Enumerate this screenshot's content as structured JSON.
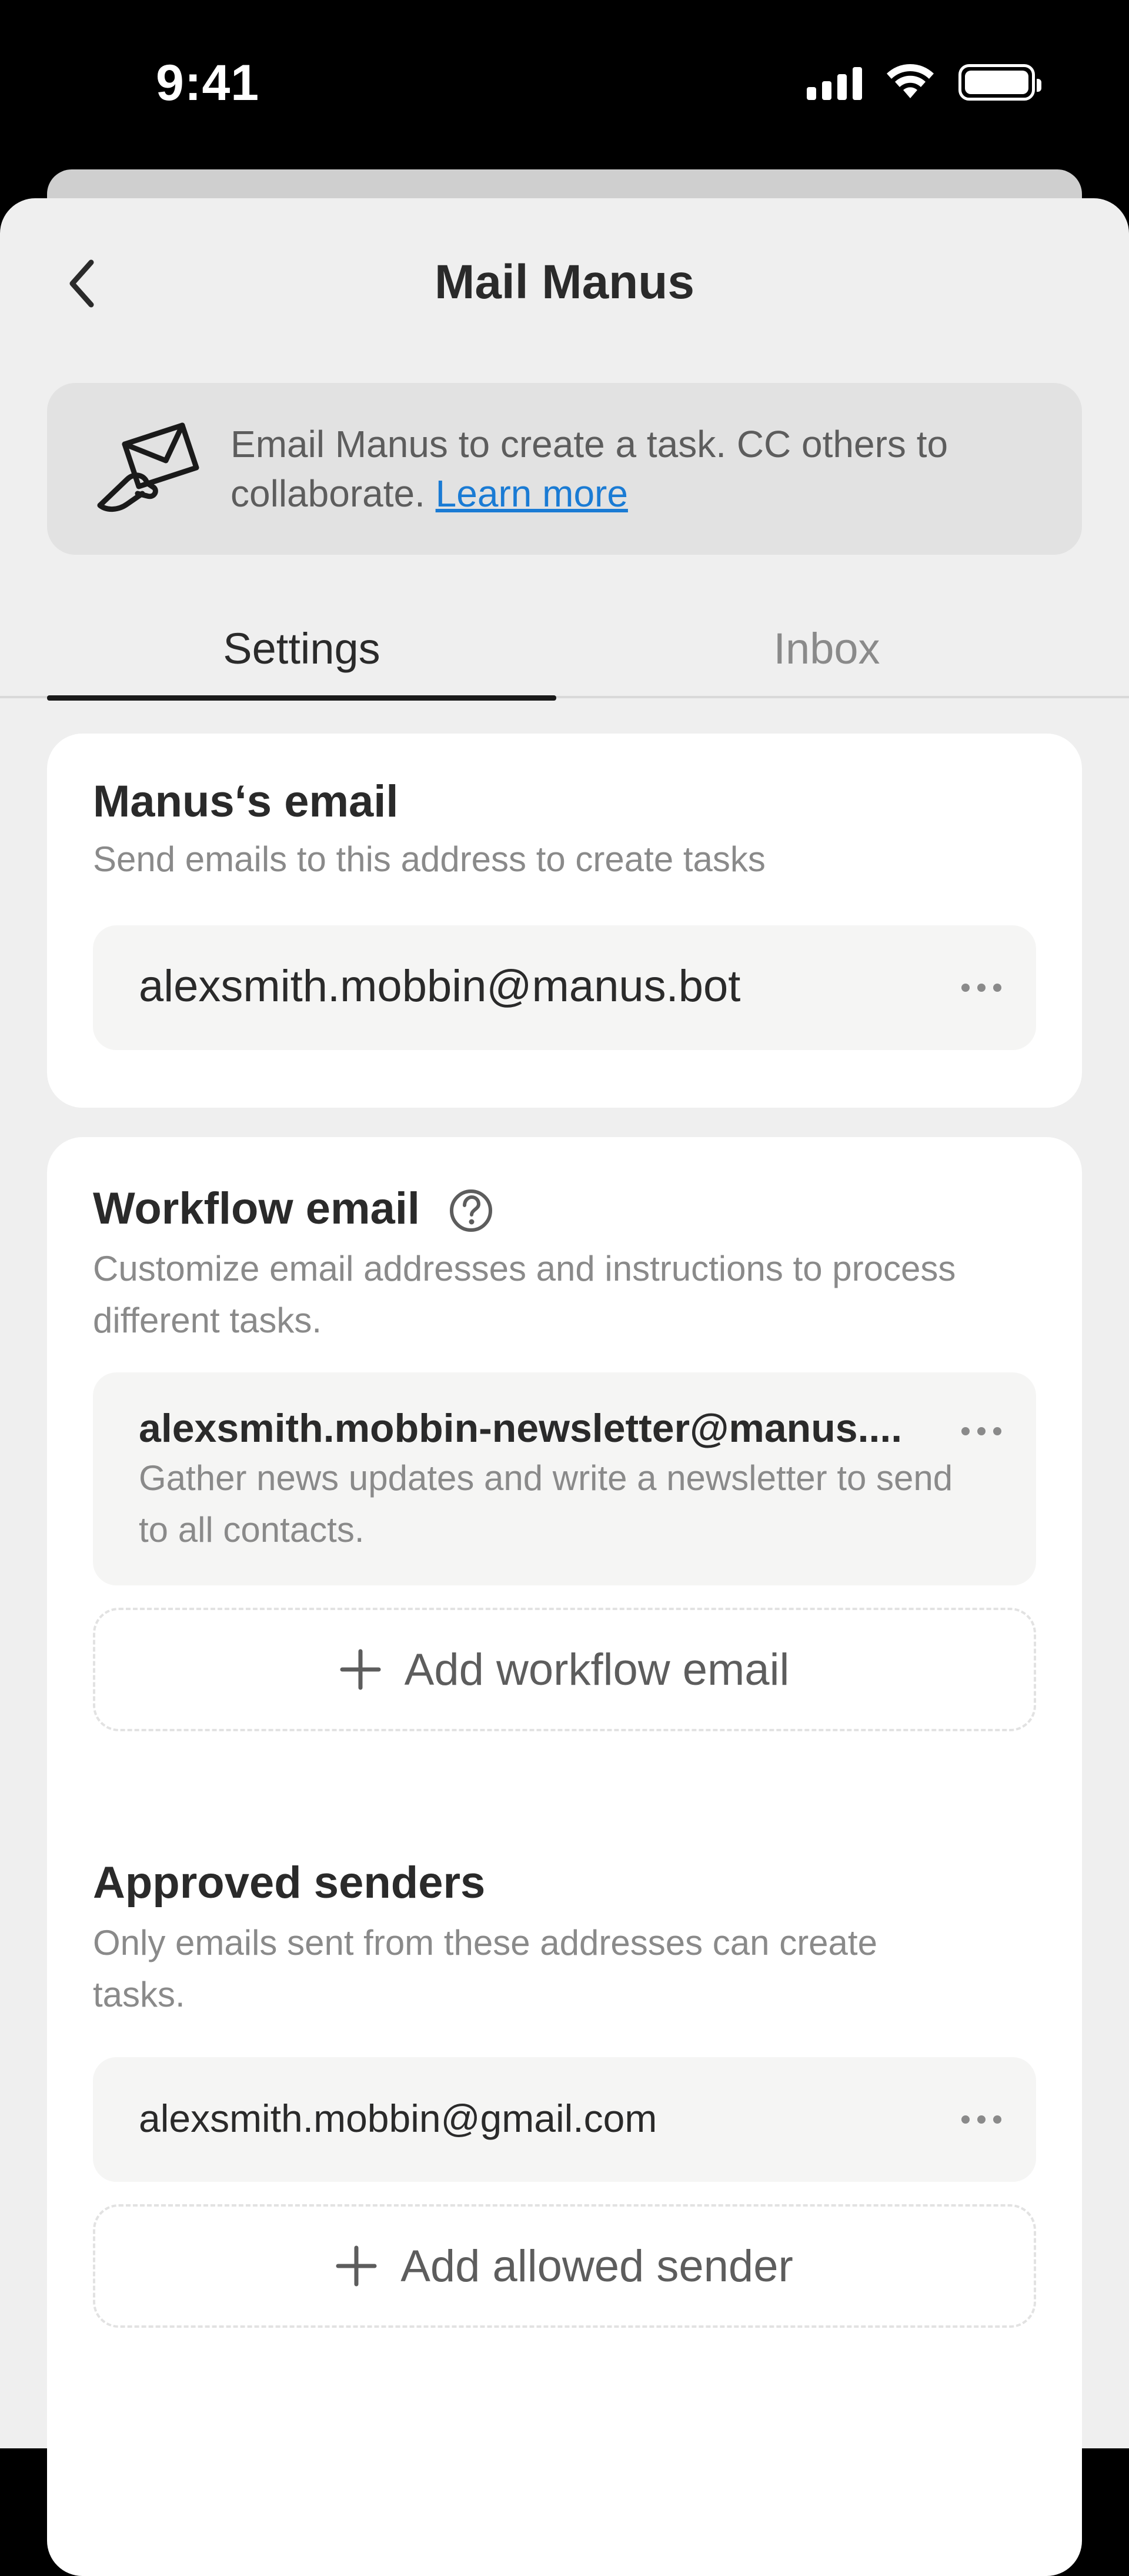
{
  "status_bar": {
    "time": "9:41",
    "icons": [
      "cellular-signal-icon",
      "wifi-icon",
      "battery-icon"
    ]
  },
  "header": {
    "title": "Mail Manus",
    "back_icon": "chevron-left-icon"
  },
  "banner": {
    "icon": "envelope-hand-icon",
    "text": "Email Manus to create a task. CC others to collaborate.",
    "link": "Learn more",
    "link_color": "#1a7bd4"
  },
  "tabs": [
    {
      "label": "Settings",
      "active": true
    },
    {
      "label": "Inbox",
      "active": false
    }
  ],
  "manus_email": {
    "title": "Manus‘s email",
    "subtitle": "Send emails to this address to create tasks",
    "address": "alexsmith.mobbin@manus.bot",
    "more_icon": "more-horizontal-icon"
  },
  "workflow_email": {
    "title": "Workflow email",
    "help_icon": "question-circle-icon",
    "subtitle": "Customize email addresses and instructions to process different tasks.",
    "items": [
      {
        "address": "alexsmith.mobbin-newsletter@manus....",
        "description": "Gather news updates and write a newsletter to send to all contacts."
      }
    ],
    "add_label": "Add workflow email"
  },
  "approved_senders": {
    "title": "Approved senders",
    "subtitle": "Only emails sent from these addresses can create tasks.",
    "items": [
      "alexsmith.mobbin@gmail.com"
    ],
    "add_label": "Add allowed sender"
  },
  "colors": {
    "sheet_background": "#efefef",
    "card_background": "#ffffff",
    "field_background": "#f5f5f4",
    "primary_text": "#2a2a2a",
    "secondary_text": "#8a8a8a"
  }
}
